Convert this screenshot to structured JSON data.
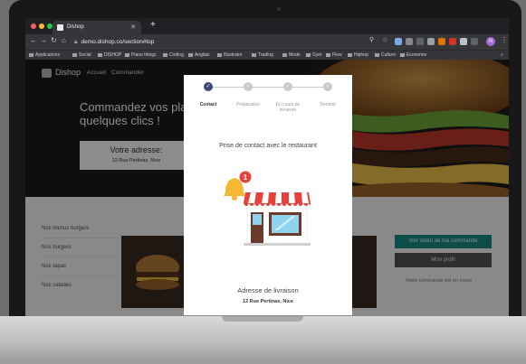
{
  "browser": {
    "tab_title": "Dishop",
    "tab_close": "✕",
    "new_tab": "+",
    "url": "demo.dishop.co/section#top",
    "bookmarks": [
      "Applications",
      "Social",
      "DISHOP",
      "Piano things",
      "Coding",
      "Anglais",
      "Illustrator",
      "Trading",
      "Mode",
      "Gym",
      "Flow",
      "Hiphop",
      "Culture",
      "Economie"
    ],
    "profile_initial": "N"
  },
  "site": {
    "brand": "Dishop",
    "nav": [
      "Accueil",
      "Commander"
    ],
    "tagline": "Commandez vos plats en quelques clics !",
    "address_box": {
      "label": "Votre adresse:",
      "value": "12 Rue Pertinax, Nice"
    },
    "menu": [
      "Nos menus burgers",
      "Nos burgers",
      "Nos tapas",
      "Nos salades"
    ],
    "buttons": {
      "status": "Voir statut de ma commande",
      "profile": "Mon profil"
    },
    "side_note": "Votre commande est en cours"
  },
  "modal": {
    "steps": [
      {
        "label": "Contact",
        "active": true
      },
      {
        "label": "Préparation",
        "active": false
      },
      {
        "label": "En cours de livraison",
        "active": false
      },
      {
        "label": "Terminé",
        "active": false
      }
    ],
    "title": "Prise de contact avec le restaurant",
    "notification_count": "1",
    "delivery_title": "Adresse de livraison",
    "delivery_address": "12 Rue Pertinax, Nice"
  },
  "colors": {
    "teal": "#1b8a86",
    "step_active": "#3b4a7a",
    "awning": "#e8413b"
  }
}
